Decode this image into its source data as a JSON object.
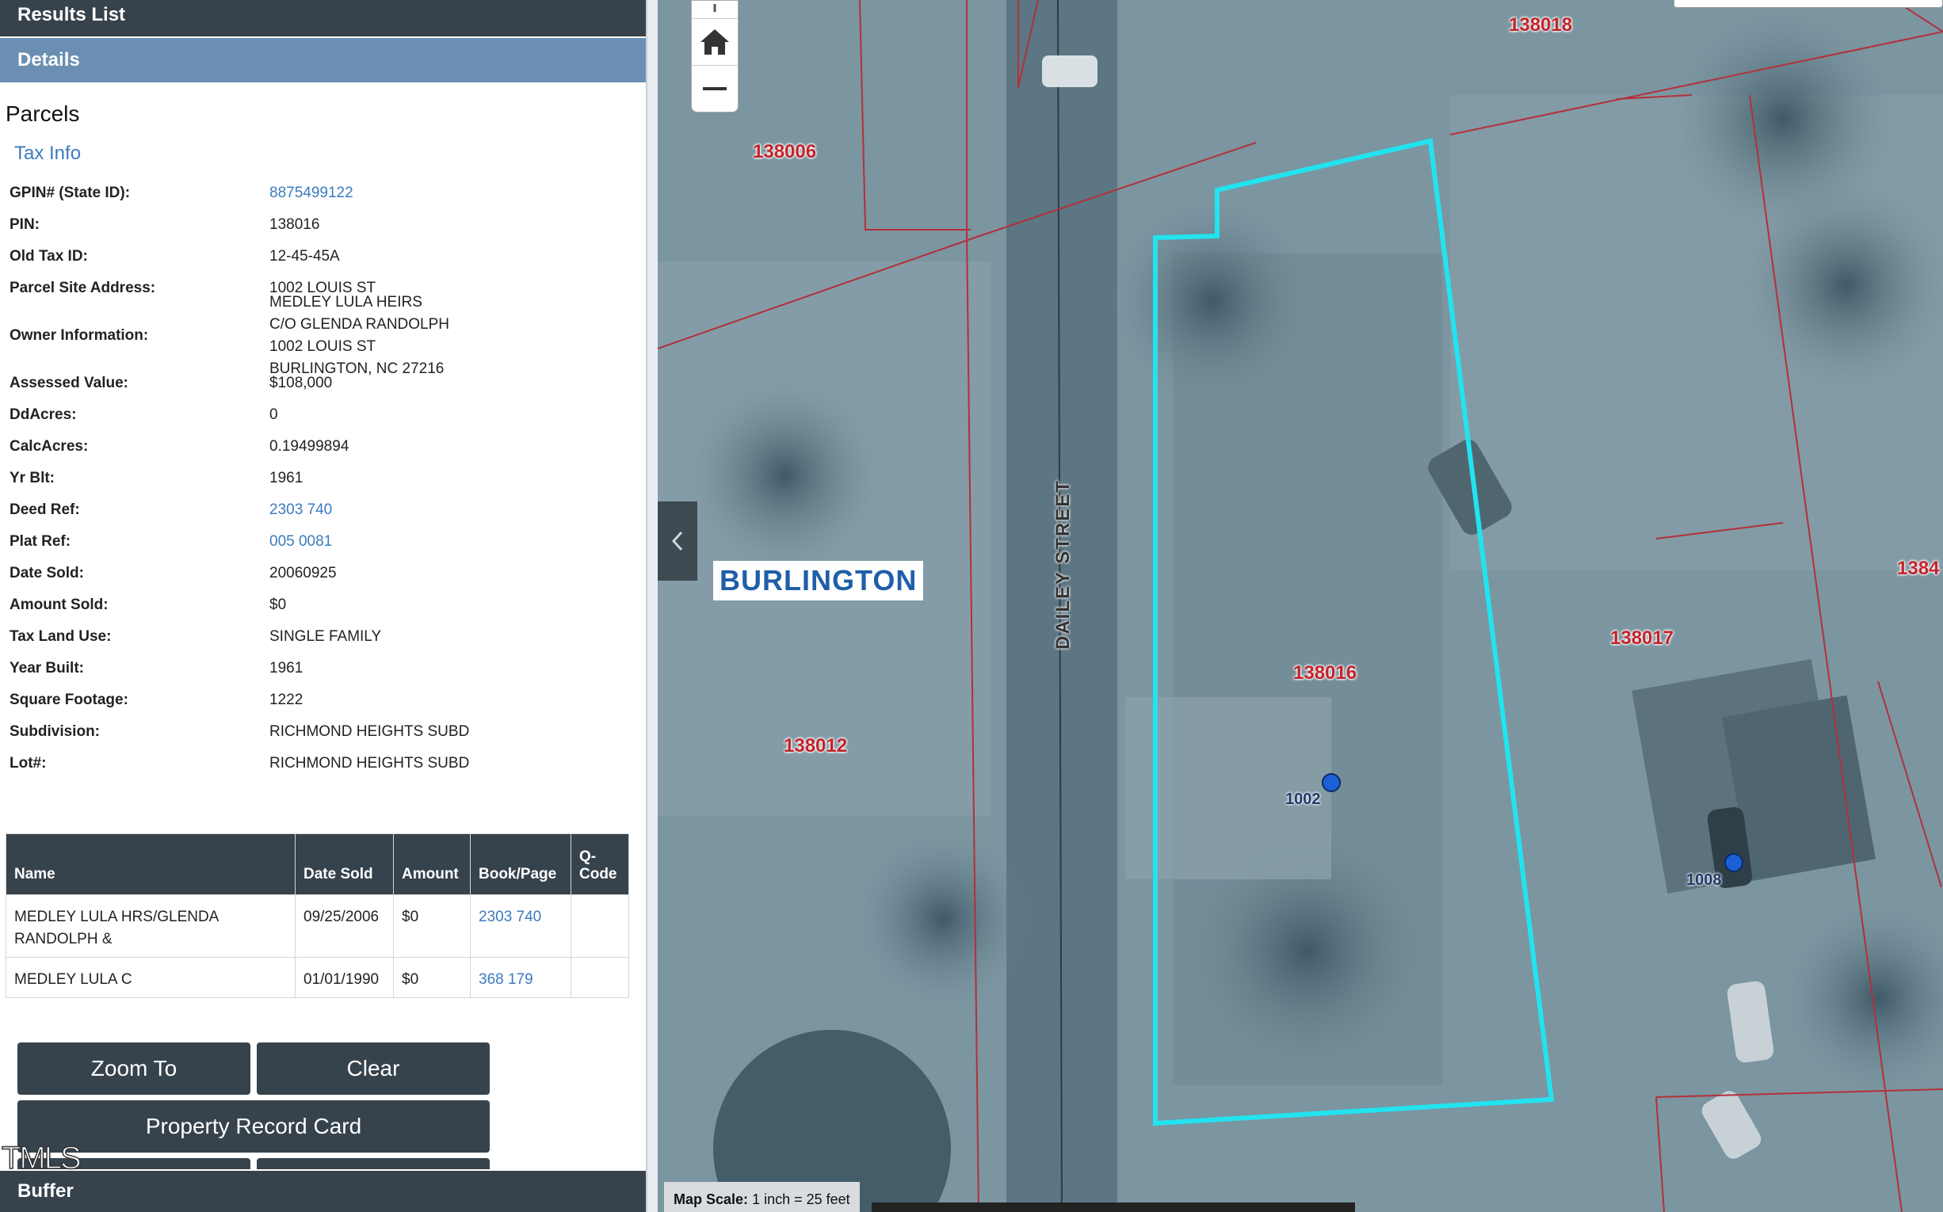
{
  "panel": {
    "results_list": "Results List",
    "details": "Details",
    "buffer": "Buffer",
    "parcels_title": "Parcels",
    "tax_info_link": "Tax Info",
    "rows": [
      {
        "label": "GPIN# (State ID):",
        "value": "8875499122",
        "link": true
      },
      {
        "label": "PIN:",
        "value": "138016"
      },
      {
        "label": "Old Tax ID:",
        "value": "12-45-45A"
      },
      {
        "label": "Parcel Site Address:",
        "value": "1002 LOUIS ST"
      },
      {
        "label": "Owner Information:",
        "value": "MEDLEY LULA HEIRS\nC/O GLENDA RANDOLPH\n1002 LOUIS ST\nBURLINGTON, NC 27216",
        "multi": true
      },
      {
        "label": "Assessed Value:",
        "value": "$108,000"
      },
      {
        "label": "DdAcres:",
        "value": "0"
      },
      {
        "label": "CalcAcres:",
        "value": "0.19499894"
      },
      {
        "label": "Yr Blt:",
        "value": "1961"
      },
      {
        "label": "Deed Ref:",
        "value": "2303 740",
        "link": true
      },
      {
        "label": "Plat Ref:",
        "value": "005 0081",
        "link": true
      },
      {
        "label": "Date Sold:",
        "value": "20060925"
      },
      {
        "label": "Amount Sold:",
        "value": "$0"
      },
      {
        "label": "Tax Land Use:",
        "value": "SINGLE FAMILY"
      },
      {
        "label": "Year Built:",
        "value": "1961"
      },
      {
        "label": "Square Footage:",
        "value": "1222"
      },
      {
        "label": "Subdivision:",
        "value": "RICHMOND HEIGHTS SUBD"
      },
      {
        "label": "Lot#:",
        "value": "RICHMOND HEIGHTS SUBD"
      }
    ],
    "sales_table": {
      "headers": [
        "Name",
        "Date Sold",
        "Amount",
        "Book/Page",
        "Q-\nCode"
      ],
      "rows": [
        [
          "MEDLEY LULA HRS/GLENDA RANDOLPH &",
          "09/25/2006",
          "$0",
          "2303 740",
          ""
        ],
        [
          "MEDLEY LULA C",
          "01/01/1990",
          "$0",
          "368 179",
          ""
        ]
      ]
    },
    "buttons": {
      "zoom_to": "Zoom To",
      "clear": "Clear",
      "property_record_card": "Property Record Card"
    },
    "watermark": "TMLS"
  },
  "map": {
    "city_label": "BURLINGTON",
    "street_label": "DAILEY STREET",
    "parcel_labels": [
      "138018",
      "138006",
      "138016",
      "138017",
      "138012",
      "1384"
    ],
    "address_labels": [
      "1002",
      "1008"
    ],
    "scale_label": "Map Scale:",
    "scale_value": "1 inch = 25 feet",
    "colors": {
      "selected_parcel": "#22e3f0",
      "parcel_lines": "#b3303a",
      "address_point": "#1d5fd6"
    }
  }
}
